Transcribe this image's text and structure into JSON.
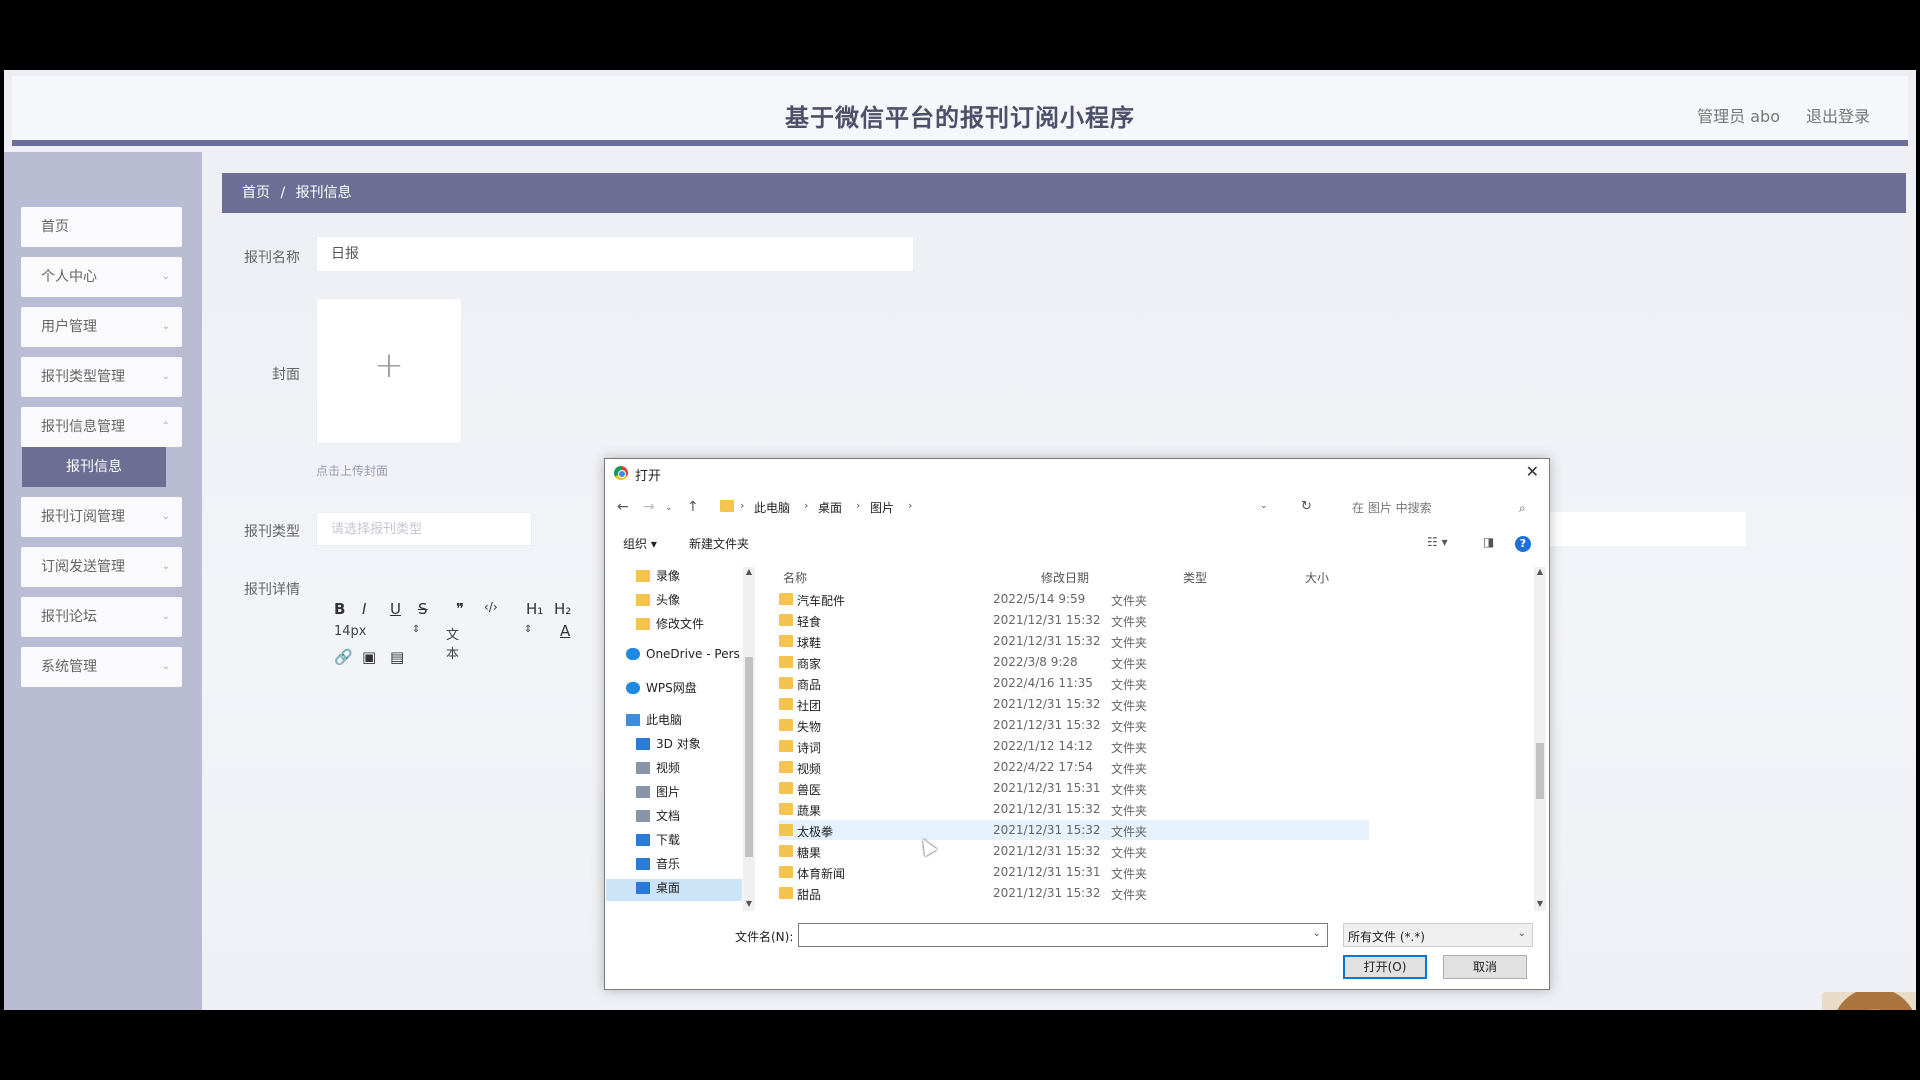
{
  "header": {
    "title": "基于微信平台的报刊订阅小程序",
    "user": "管理员 abo",
    "logout": "退出登录"
  },
  "sidebar": {
    "items": [
      {
        "label": "首页"
      },
      {
        "label": "个人中心"
      },
      {
        "label": "用户管理"
      },
      {
        "label": "报刊类型管理"
      },
      {
        "label": "报刊信息管理"
      },
      {
        "label": "报刊订阅管理"
      },
      {
        "label": "订阅发送管理"
      },
      {
        "label": "报刊论坛"
      },
      {
        "label": "系统管理"
      }
    ],
    "active_sub": "报刊信息"
  },
  "breadcrumb": {
    "home": "首页",
    "separator": "/",
    "current": "报刊信息"
  },
  "form": {
    "name_label": "报刊名称",
    "name_value": "日报",
    "cover_label": "封面",
    "upload_hint": "点击上传封面",
    "type_label": "报刊类型",
    "type_placeholder": "请选择报刊类型",
    "detail_label": "报刊详情",
    "editor": {
      "bold": "B",
      "italic": "I",
      "underline": "U",
      "strike": "S",
      "quote": "❞",
      "code": "‹/›",
      "h1": "H₁",
      "h2": "H₂",
      "size": "14px",
      "format": "文本",
      "font_color": "A"
    }
  },
  "dialog": {
    "title": "打开",
    "path": [
      "此电脑",
      "桌面",
      "图片"
    ],
    "search_placeholder": "在 图片 中搜索",
    "organize": "组织 ▾",
    "new_folder": "新建文件夹",
    "help": "?",
    "nav": [
      {
        "label": "录像",
        "icon": "folder-icon"
      },
      {
        "label": "头像",
        "icon": "folder-icon"
      },
      {
        "label": "修改文件",
        "icon": "folder-icon"
      },
      {
        "label": "OneDrive - Pers",
        "icon": "onedrive-icon"
      },
      {
        "label": "WPS网盘",
        "icon": "wps-cloud-icon"
      },
      {
        "label": "此电脑",
        "icon": "pc-icon"
      },
      {
        "label": "3D 对象",
        "icon": "3d-objects-icon"
      },
      {
        "label": "视频",
        "icon": "video-icon"
      },
      {
        "label": "图片",
        "icon": "picture-icon"
      },
      {
        "label": "文档",
        "icon": "document-icon"
      },
      {
        "label": "下载",
        "icon": "download-icon"
      },
      {
        "label": "音乐",
        "icon": "music-icon"
      },
      {
        "label": "桌面",
        "icon": "desktop-icon"
      }
    ],
    "columns": {
      "name": "名称",
      "date": "修改日期",
      "type": "类型",
      "size": "大小"
    },
    "files": [
      {
        "name": "汽车配件",
        "date": "2022/5/14 9:59",
        "type": "文件夹"
      },
      {
        "name": "轻食",
        "date": "2021/12/31 15:32",
        "type": "文件夹"
      },
      {
        "name": "球鞋",
        "date": "2021/12/31 15:32",
        "type": "文件夹"
      },
      {
        "name": "商家",
        "date": "2022/3/8 9:28",
        "type": "文件夹"
      },
      {
        "name": "商品",
        "date": "2022/4/16 11:35",
        "type": "文件夹"
      },
      {
        "name": "社团",
        "date": "2021/12/31 15:32",
        "type": "文件夹"
      },
      {
        "name": "失物",
        "date": "2021/12/31 15:32",
        "type": "文件夹"
      },
      {
        "name": "诗词",
        "date": "2022/1/12 14:12",
        "type": "文件夹"
      },
      {
        "name": "视频",
        "date": "2022/4/22 17:54",
        "type": "文件夹"
      },
      {
        "name": "兽医",
        "date": "2021/12/31 15:31",
        "type": "文件夹"
      },
      {
        "name": "蔬果",
        "date": "2021/12/31 15:32",
        "type": "文件夹"
      },
      {
        "name": "太极拳",
        "date": "2021/12/31 15:32",
        "type": "文件夹"
      },
      {
        "name": "糖果",
        "date": "2021/12/31 15:32",
        "type": "文件夹"
      },
      {
        "name": "体育新闻",
        "date": "2021/12/31 15:31",
        "type": "文件夹"
      },
      {
        "name": "甜品",
        "date": "2021/12/31 15:32",
        "type": "文件夹"
      }
    ],
    "filename_label": "文件名(N):",
    "filename_value": "",
    "filetype": "所有文件 (*.*)",
    "open_button": "打开(O)",
    "cancel_button": "取消"
  }
}
